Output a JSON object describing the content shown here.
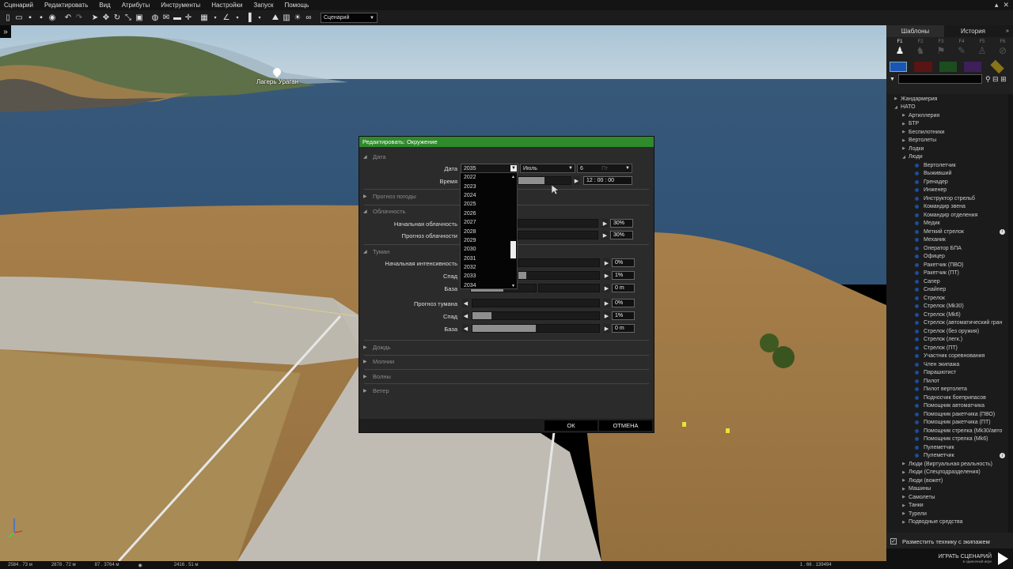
{
  "menu": [
    "Сценарий",
    "Редактировать",
    "Вид",
    "Атрибуты",
    "Инструменты",
    "Настройки",
    "Запуск",
    "Помощь"
  ],
  "toolbar": {
    "mode_select": "Сценарий"
  },
  "map": {
    "location_label": "Лагерь Ураган"
  },
  "status": {
    "x": "2584 . 73  м",
    "y": "2878 . 72  м",
    "z": "87 . 3764  м",
    "dist": "2416 . 51  м",
    "version": "1 . 66 . 139494"
  },
  "dialog": {
    "title": "Редактировать: Окружение",
    "sections": {
      "date": "Дата",
      "weather_forecast": "Прогноз погоды",
      "overcast": "Облачность",
      "fog": "Туман",
      "rain": "Дождь",
      "lightning": "Молнии",
      "waves": "Волны",
      "wind": "Ветер"
    },
    "labels": {
      "date": "Дата",
      "time": "Время",
      "overcast_start": "Начальная облачность",
      "overcast_forecast": "Прогноз облачности",
      "fog_start": "Начальная интенсивность",
      "fog_decay": "Спад",
      "fog_base": "База",
      "fog_forecast": "Прогноз тумана",
      "fog_decay2": "Спад",
      "fog_base2": "База"
    },
    "values": {
      "year": "2035",
      "month": "Июль",
      "day": "6",
      "day_hint": "Пт",
      "time": "12 : 00 : 00",
      "overcast_start": "30%",
      "overcast_forecast": "30%",
      "fog_start": "0%",
      "fog_decay": "1%",
      "fog_base": "0 m",
      "fog_forecast": "0%",
      "fog_decay2": "1%",
      "fog_base2": "0 m"
    },
    "levels": {
      "time": 0.5,
      "fog_decay": 0.1,
      "fog_base": 0.5,
      "fog_decay2": 0.15,
      "fog_base2": 0.5
    },
    "year_options": [
      "2022",
      "2023",
      "2024",
      "2025",
      "2026",
      "2027",
      "2028",
      "2029",
      "2030",
      "2031",
      "2032",
      "2033",
      "2034"
    ],
    "ok": "ОК",
    "cancel": "ОТМЕНА"
  },
  "panel": {
    "tab_templates": "Шаблоны",
    "tab_history": "История",
    "factions": [
      "F1",
      "F2",
      "F3",
      "F4",
      "F5",
      "F6"
    ],
    "colors": [
      "#1a56b5",
      "#8a1a1a",
      "#1f6a24",
      "#5d2a86",
      "#b59a1a"
    ],
    "tree": [
      {
        "label": "Жандармерия",
        "level": 0
      },
      {
        "label": "НАТО",
        "level": 0
      },
      {
        "label": "Артиллерия",
        "level": 1
      },
      {
        "label": "БТР",
        "level": 1
      },
      {
        "label": "Беспилотники",
        "level": 1
      },
      {
        "label": "Вертолеты",
        "level": 1
      },
      {
        "label": "Лодки",
        "level": 1
      },
      {
        "label": "Люди",
        "level": 1
      },
      {
        "label": "Вертолетчик",
        "level": 2
      },
      {
        "label": "Выживший",
        "level": 2
      },
      {
        "label": "Гренадер",
        "level": 2
      },
      {
        "label": "Инженер",
        "level": 2
      },
      {
        "label": "Инструктор стрельб",
        "level": 2
      },
      {
        "label": "Командир звена",
        "level": 2
      },
      {
        "label": "Командир отделения",
        "level": 2
      },
      {
        "label": "Медик",
        "level": 2
      },
      {
        "label": "Меткий стрелок",
        "level": 2,
        "info": true
      },
      {
        "label": "Механик",
        "level": 2
      },
      {
        "label": "Оператор БПА",
        "level": 2
      },
      {
        "label": "Офицер",
        "level": 2
      },
      {
        "label": "Ракетчик (ПВО)",
        "level": 2
      },
      {
        "label": "Ракетчик (ПТ)",
        "level": 2
      },
      {
        "label": "Сапер",
        "level": 2
      },
      {
        "label": "Снайпер",
        "level": 2
      },
      {
        "label": "Стрелок",
        "level": 2
      },
      {
        "label": "Стрелок (Mk30)",
        "level": 2
      },
      {
        "label": "Стрелок (Mk6)",
        "level": 2
      },
      {
        "label": "Стрелок (автоматический гран",
        "level": 2
      },
      {
        "label": "Стрелок (без оружия)",
        "level": 2
      },
      {
        "label": "Стрелок (легк.)",
        "level": 2
      },
      {
        "label": "Стрелок (ПТ)",
        "level": 2
      },
      {
        "label": "Участник соревнования",
        "level": 2
      },
      {
        "label": "Член экипажа",
        "level": 2
      },
      {
        "label": "Парашютист",
        "level": 2
      },
      {
        "label": "Пилот",
        "level": 2
      },
      {
        "label": "Пилот вертолета",
        "level": 2
      },
      {
        "label": "Подносчик боеприпасов",
        "level": 2
      },
      {
        "label": "Помощник автоматчика",
        "level": 2
      },
      {
        "label": "Помощник ракетчика (ПВО)",
        "level": 2
      },
      {
        "label": "Помощник ракетчика (ПТ)",
        "level": 2
      },
      {
        "label": "Помощник стрелка (Mk30/авто",
        "level": 2
      },
      {
        "label": "Помощник стрелка (Mk6)",
        "level": 2
      },
      {
        "label": "Пулеметчик",
        "level": 2
      },
      {
        "label": "Пулеметчик",
        "level": 2,
        "info": true
      },
      {
        "label": "Люди (Виртуальная реальность)",
        "level": 1
      },
      {
        "label": "Люди (Спецподразделения)",
        "level": 1
      },
      {
        "label": "Люди (вожет)",
        "level": 1
      },
      {
        "label": "Машины",
        "level": 1
      },
      {
        "label": "Самолеты",
        "level": 1
      },
      {
        "label": "Танки",
        "level": 1
      },
      {
        "label": "Турели",
        "level": 1
      },
      {
        "label": "Подводные средства",
        "level": 1
      }
    ],
    "checkbox_label": "Разместить технику с экипажем",
    "play_title": "ИГРАТЬ СЦЕНАРИЙ",
    "play_sub": "в одиночной игре"
  }
}
